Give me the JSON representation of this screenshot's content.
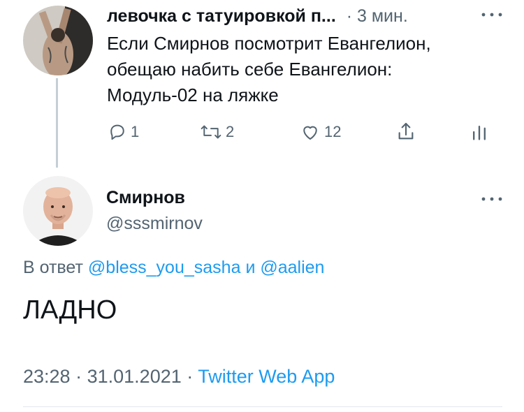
{
  "parent_tweet": {
    "author_name": "левочка с татуировкой п...",
    "time": "3 мин.",
    "separator": "·",
    "text_lines": [
      "Если Смирнов посмотрит Евангелион,",
      "обещаю набить себе Евангелион:",
      "Модуль-02 на ляжке"
    ],
    "actions": {
      "reply_count": "1",
      "retweet_count": "2",
      "like_count": "12"
    }
  },
  "reply_tweet": {
    "author_name": "Смирнов",
    "handle": "@sssmirnov",
    "reply_prefix": "В ответ",
    "reply_user1": "@bless_you_sasha",
    "reply_and": "и",
    "reply_user2": "@aalien",
    "text": "ЛАДНО",
    "time": "23:28",
    "date": "31.01.2021",
    "source": "Twitter Web App",
    "dot": "·"
  },
  "colors": {
    "text": "#0f1419",
    "muted": "#536471",
    "link": "#1d9bf0",
    "thread_line": "#c4cfd6"
  }
}
